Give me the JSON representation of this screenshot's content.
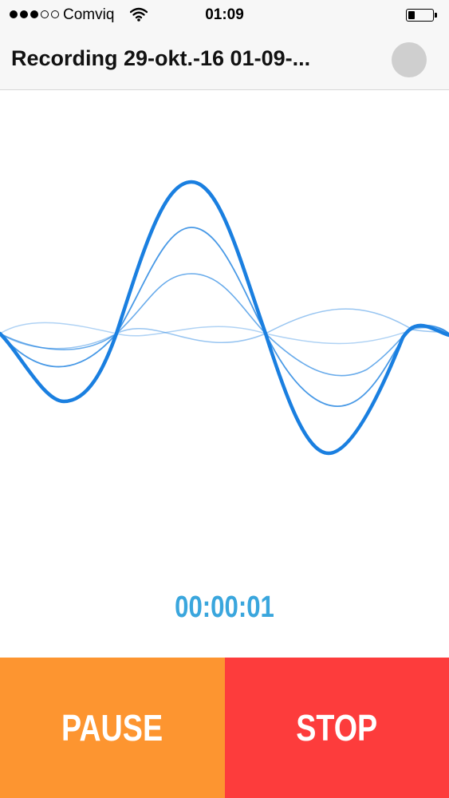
{
  "status_bar": {
    "signal_filled": 3,
    "signal_total": 5,
    "carrier": "Comviq",
    "time": "01:09",
    "battery_level": 0.2
  },
  "header": {
    "title": "Recording 29-okt.-16 01-09-..."
  },
  "recorder": {
    "elapsed": "00:00:01"
  },
  "controls": {
    "pause_label": "PAUSE",
    "stop_label": "STOP"
  },
  "colors": {
    "accent_wave": "#1a7fe0",
    "timer": "#3aa6dd",
    "pause": "#fd9530",
    "stop": "#fd3c3c",
    "record_indicator": "#cfcfcf"
  }
}
